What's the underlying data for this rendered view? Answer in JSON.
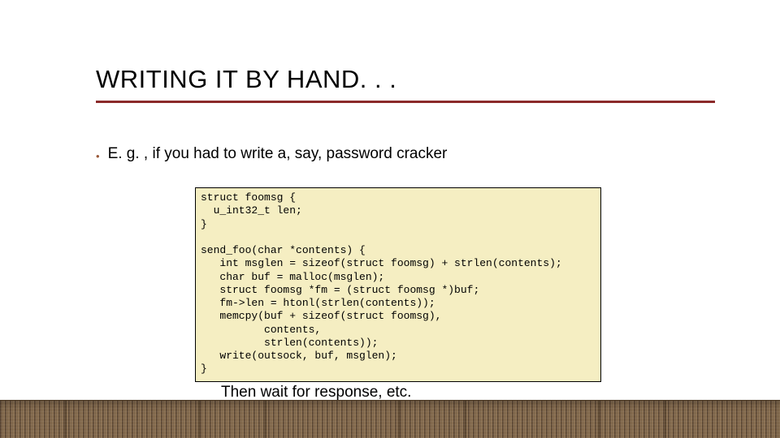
{
  "title": "WRITING IT BY HAND. . .",
  "bullet": "E. g. , if you had to write a, say, password cracker",
  "code": "struct foomsg {\n  u_int32_t len;\n}\n\nsend_foo(char *contents) {\n   int msglen = sizeof(struct foomsg) + strlen(contents);\n   char buf = malloc(msglen);\n   struct foomsg *fm = (struct foomsg *)buf;\n   fm->len = htonl(strlen(contents));\n   memcpy(buf + sizeof(struct foomsg),\n          contents,\n          strlen(contents));\n   write(outsock, buf, msglen);\n}",
  "caption": "Then wait for response, etc."
}
